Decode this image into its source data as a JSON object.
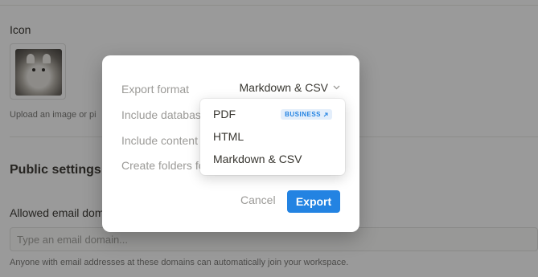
{
  "background": {
    "icon_label": "Icon",
    "upload_hint": "Upload an image or pi",
    "public_settings_title": "Public settings",
    "allowed_email_label": "Allowed email dom",
    "email_placeholder": "Type an email domain...",
    "email_help": "Anyone with email addresses at these domains can automatically join your workspace."
  },
  "dialog": {
    "export_format_label": "Export format",
    "export_format_value": "Markdown & CSV",
    "chevron_icon": "chevron-down-icon",
    "include_databases_label": "Include databases",
    "include_content_label": "Include content",
    "create_folders_label": "Create folders fo",
    "cancel_label": "Cancel",
    "export_label": "Export"
  },
  "dropdown": {
    "options": [
      {
        "label": "PDF",
        "badge": "BUSINESS",
        "badge_icon": "arrow-up-right-icon"
      },
      {
        "label": "HTML"
      },
      {
        "label": "Markdown & CSV"
      }
    ]
  },
  "colors": {
    "accent": "#2383e2",
    "overlay": "rgba(15,15,15,0.42)",
    "badge_bg": "#e3eefb"
  }
}
